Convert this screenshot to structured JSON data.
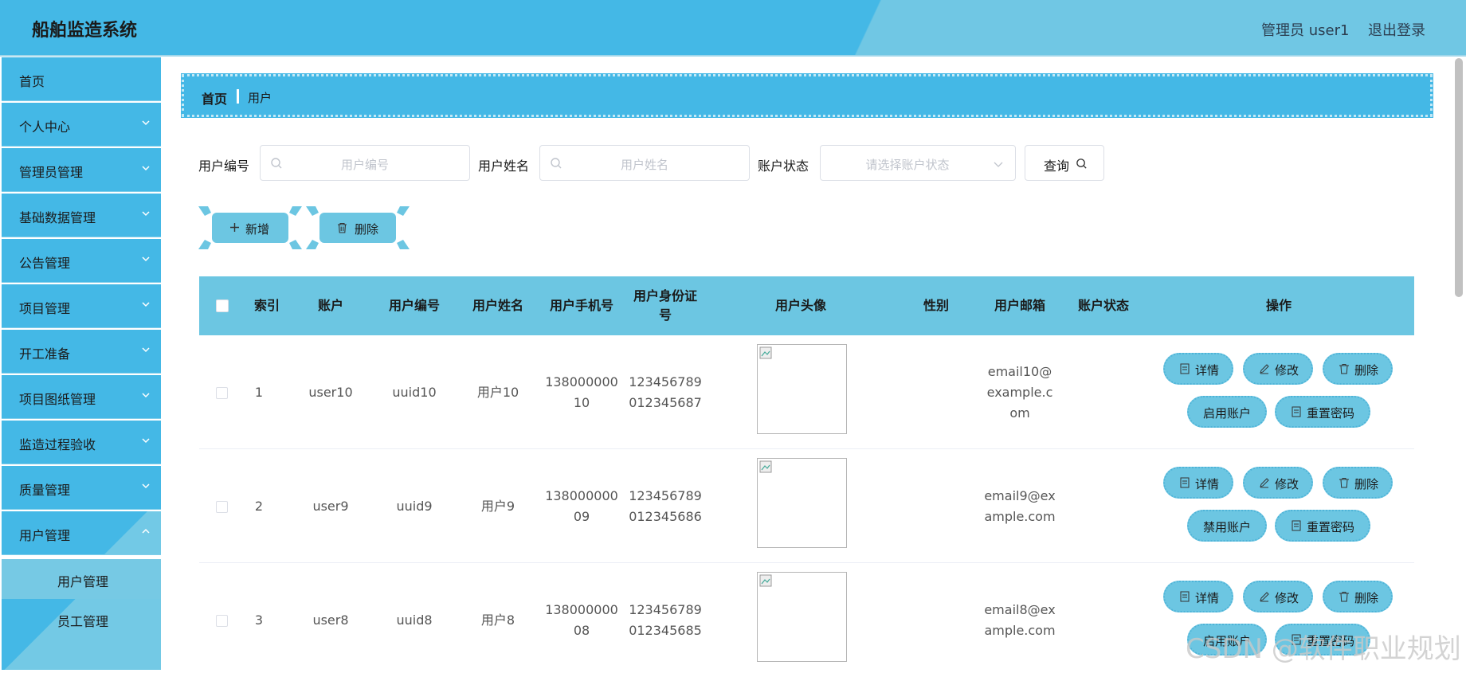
{
  "header": {
    "brand": "船舶监造系统",
    "user": "管理员 user1",
    "logout": "退出登录"
  },
  "sidebar": {
    "items": [
      {
        "label": "首页"
      },
      {
        "label": "个人中心"
      },
      {
        "label": "管理员管理"
      },
      {
        "label": "基础数据管理"
      },
      {
        "label": "公告管理"
      },
      {
        "label": "项目管理"
      },
      {
        "label": "开工准备"
      },
      {
        "label": "项目图纸管理"
      },
      {
        "label": "监造过程验收"
      },
      {
        "label": "质量管理"
      },
      {
        "label": "用户管理"
      }
    ],
    "submenu": [
      {
        "label": "用户管理"
      },
      {
        "label": "员工管理"
      }
    ]
  },
  "breadcrumb": {
    "home": "首页",
    "current": "用户"
  },
  "search": {
    "uid_label": "用户编号",
    "uid_placeholder": "用户编号",
    "name_label": "用户姓名",
    "name_placeholder": "用户姓名",
    "status_label": "账户状态",
    "status_placeholder": "请选择账户状态",
    "query": "查询"
  },
  "actions": {
    "add": "新增",
    "delete": "删除"
  },
  "table": {
    "headers": {
      "index": "索引",
      "account": "账户",
      "uid": "用户编号",
      "name": "用户姓名",
      "phone": "用户手机号",
      "idcard_1": "用户身份证",
      "idcard_2": "号",
      "avatar": "用户头像",
      "gender": "性别",
      "email": "用户邮箱",
      "status": "账户状态",
      "ops": "操作"
    },
    "rows": [
      {
        "index": "1",
        "account": "user10",
        "uid": "uuid10",
        "name": "用户10",
        "phone_1": "138000000",
        "phone_2": "10",
        "id_1": "123456789",
        "id_2": "012345687",
        "email_1": "email10@",
        "email_2": "example.c",
        "email_3": "om",
        "toggle": "启用账户"
      },
      {
        "index": "2",
        "account": "user9",
        "uid": "uuid9",
        "name": "用户9",
        "phone_1": "138000000",
        "phone_2": "09",
        "id_1": "123456789",
        "id_2": "012345686",
        "email_1": "email9@ex",
        "email_2": "ample.com",
        "email_3": "",
        "toggle": "禁用账户"
      },
      {
        "index": "3",
        "account": "user8",
        "uid": "uuid8",
        "name": "用户8",
        "phone_1": "138000000",
        "phone_2": "08",
        "id_1": "123456789",
        "id_2": "012345685",
        "email_1": "email8@ex",
        "email_2": "ample.com",
        "email_3": "",
        "toggle": "启用账户"
      }
    ],
    "op_labels": {
      "detail": "详情",
      "edit": "修改",
      "delete": "删除",
      "reset": "重置密码"
    }
  },
  "watermark": "CSDN @软件职业规划",
  "colors": {
    "primary": "#44b8e6",
    "light": "#6cc6e2"
  }
}
